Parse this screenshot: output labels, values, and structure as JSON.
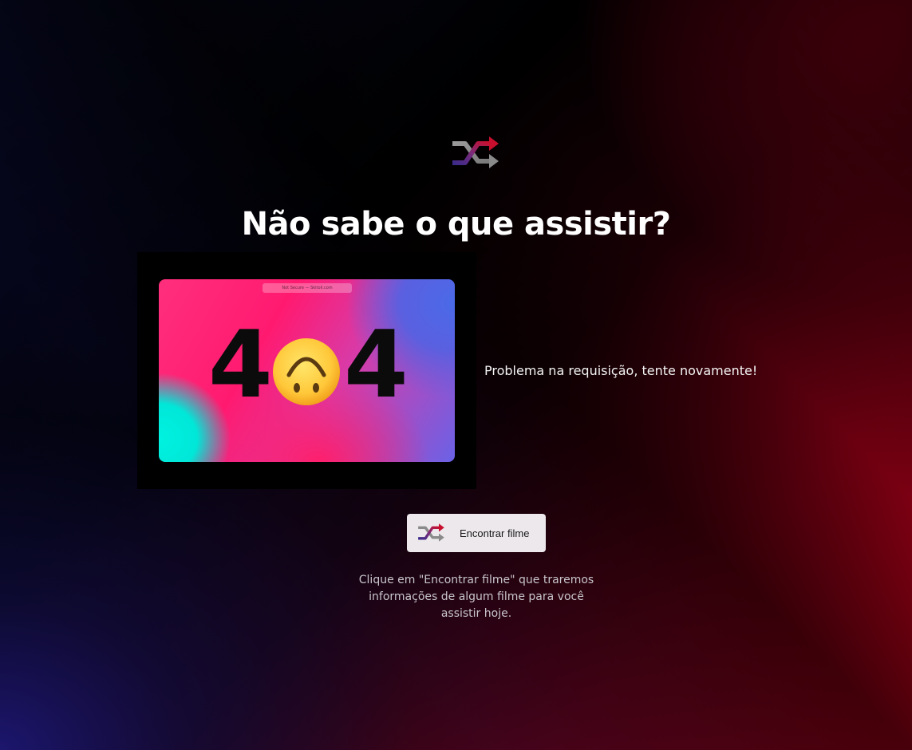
{
  "header": {
    "logo_icon": "shuffle-icon",
    "title": "Não sabe o que assistir?"
  },
  "error_card": {
    "image_alt": "404 error illustration",
    "url_bar_text": "Not Secure — Skitoli.com",
    "digit_left": "4",
    "digit_right": "4",
    "emoji_icon": "upside-down-face-icon",
    "message": "Problema na requisição, tente novamente!"
  },
  "action": {
    "button_icon": "shuffle-icon",
    "button_label": "Encontrar filme"
  },
  "hint": {
    "text": "Clique em \"Encontrar filme\" que traremos informações de algum filme para você assistir hoje."
  },
  "colors": {
    "accent_red": "#a00015",
    "accent_blue": "#1c166e",
    "button_bg": "#ece8ec"
  }
}
